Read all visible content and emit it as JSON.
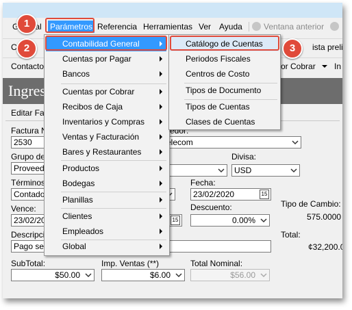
{
  "menubar": {
    "items": [
      "General",
      "Parámetros",
      "Referencia",
      "Herramientas",
      "Ver",
      "Ayuda"
    ],
    "ventana_anterior": "Ventana anterior"
  },
  "toolbar": {
    "left": "C",
    "right": "ista prelim"
  },
  "toolbar2": {
    "left": "Contacto",
    "right1": "or Cobrar",
    "right2": "In"
  },
  "banner": {
    "title": "Ingres"
  },
  "tab": {
    "label": "Editar Fact"
  },
  "form": {
    "factura_label": "Factura N",
    "factura_value": "2530",
    "proveedor_label": "edor:",
    "proveedor_value": "elecom",
    "grupo_label": "Grupo de",
    "grupo_value": "Proveedo",
    "divisa_label": "Divisa:",
    "divisa_value": "USD",
    "terminos_label": "Términos:",
    "terminos_value": "Contado",
    "fecha_label": "Fecha:",
    "fecha_value": "23/02/2020",
    "tipo_cambio_label": "Tipo de Cambio:",
    "tipo_cambio_value": "575.0000",
    "vence_label": "Vence:",
    "vence_value": "23/02/20",
    "descuento_label": "Descuento:",
    "descuento_value": "0.00%",
    "descripcion_label": "Descripci",
    "descripcion_value": "Pago ser",
    "total_label": "Total:",
    "total_value": "¢32,200.0",
    "subtotal_label": "SubTotal:",
    "subtotal_value": "$50.00",
    "imp_label": "Imp. Ventas (**)",
    "imp_value": "$6.00",
    "total_nominal_label": "Total Nominal:",
    "total_nominal_value": "$56.00"
  },
  "menu_parametros": {
    "items": [
      "Contabilidad General",
      "Cuentas por Pagar",
      "Bancos",
      "Cuentas por Cobrar",
      "Recibos de Caja",
      "Inventarios y Compras",
      "Ventas y Facturación",
      "Bares y Restaurantes",
      "Productos",
      "Bodegas",
      "Planillas",
      "Clientes",
      "Empleados",
      "Global"
    ]
  },
  "menu_contabilidad": {
    "items": [
      "Catálogo de Cuentas",
      "Periodos Fiscales",
      "Centros de Costo",
      "Tipos de Documento",
      "Tipos de Cuentas",
      "Clases de Cuentas"
    ]
  },
  "badges": [
    "1",
    "2",
    "3"
  ],
  "colors": {
    "highlight": "#3399ff",
    "callout": "#e04a3a",
    "banner": "#6d6d6d"
  }
}
